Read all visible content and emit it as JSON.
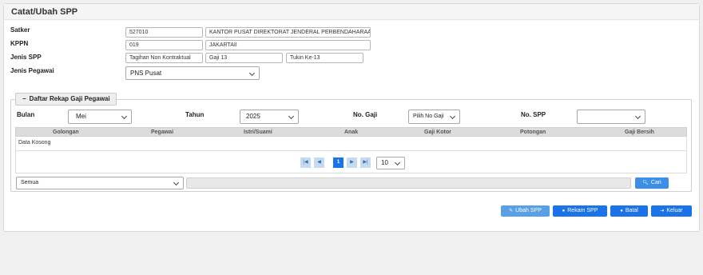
{
  "panel": {
    "title": "Catat/Ubah SPP"
  },
  "form": {
    "satker": {
      "label": "Satker",
      "code": "527010",
      "name": "KANTOR PUSAT DIREKTORAT JENDERAL PERBENDAHARAAN"
    },
    "kppn": {
      "label": "KPPN",
      "code": "019",
      "name": "JAKARTAII"
    },
    "jenis_spp": {
      "label": "Jenis SPP",
      "values": [
        "Tagihan Non Kontraktual",
        "Gaji 13",
        "Tukin Ke-13"
      ]
    },
    "jenis_pegawai": {
      "label": "Jenis Pegawai",
      "value": "PNS Pusat"
    }
  },
  "rekap": {
    "toggle_label": "Daftar Rekap Gaji Pegawai",
    "filters": {
      "bulan": {
        "label": "Bulan",
        "value": "Mei"
      },
      "tahun": {
        "label": "Tahun",
        "value": "2025"
      },
      "no_gaji": {
        "label": "No. Gaji",
        "value": "Pilih No Gaji"
      },
      "no_spp": {
        "label": "No. SPP",
        "value": ""
      }
    },
    "columns": [
      "Golongan",
      "Pegawai",
      "Istri/Suami",
      "Anak",
      "Gaji Kotor",
      "Potongan",
      "Gaji Bersih"
    ],
    "empty_text": "Data Kosong",
    "pager": {
      "current_page": "1",
      "page_size": "10"
    },
    "search": {
      "scope": "Semua",
      "query": "",
      "button": "Cari"
    }
  },
  "actions": {
    "ubah": "Ubah SPP",
    "rekam": "Rekam SPP",
    "batal": "Batal",
    "keluar": "Keluar"
  },
  "colors": {
    "primary": "#1a73e8",
    "primary_light": "#5aa0e6",
    "pager_btn": "#c6daf0",
    "header_bg": "#f5f5f5"
  }
}
